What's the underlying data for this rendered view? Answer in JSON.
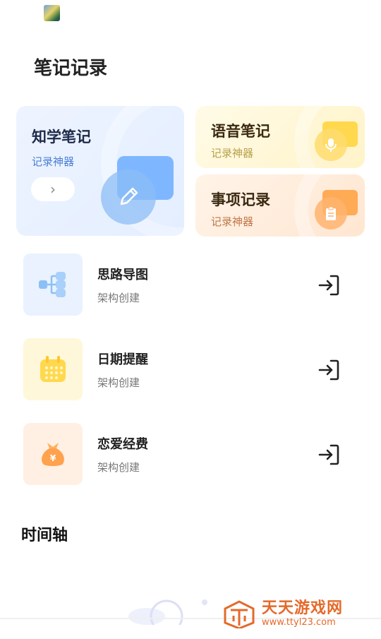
{
  "header": {
    "title": "笔记记录"
  },
  "cards": {
    "knowledge": {
      "title": "知学笔记",
      "subtitle": "记录神器"
    },
    "voice": {
      "title": "语音笔记",
      "subtitle": "记录神器"
    },
    "task": {
      "title": "事项记录",
      "subtitle": "记录神器"
    }
  },
  "list": [
    {
      "title": "思路导图",
      "subtitle": "架构创建",
      "icon": "mind-map-icon",
      "color": "#eaf2ff"
    },
    {
      "title": "日期提醒",
      "subtitle": "架构创建",
      "icon": "calendar-icon",
      "color": "#fff7d9"
    },
    {
      "title": "恋爱经费",
      "subtitle": "架构创建",
      "icon": "money-bag-icon",
      "color": "#fff0e3"
    }
  ],
  "timeline": {
    "title": "时间轴"
  },
  "watermark": {
    "name": "天天游戏网",
    "url": "www.ttyl23.com"
  },
  "colors": {
    "blue_accent": "#4a7fd6",
    "yellow_accent": "#ffd84d",
    "orange_accent": "#ffaa55",
    "watermark": "#e46a2a"
  }
}
